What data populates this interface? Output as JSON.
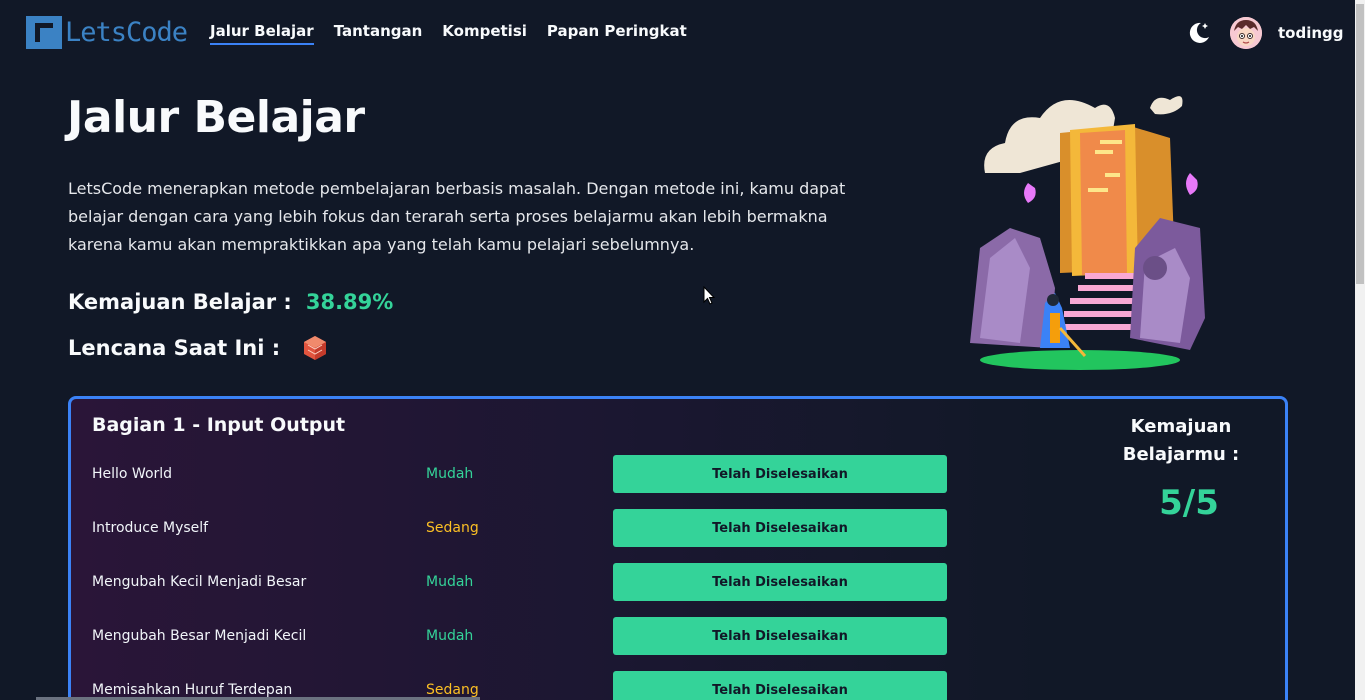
{
  "brand": {
    "name": "LetsCode"
  },
  "nav": {
    "items": [
      {
        "label": "Jalur Belajar",
        "active": true
      },
      {
        "label": "Tantangan",
        "active": false
      },
      {
        "label": "Kompetisi",
        "active": false
      },
      {
        "label": "Papan Peringkat",
        "active": false
      }
    ],
    "theme_icon": "moon-icon",
    "username": "todingg"
  },
  "hero": {
    "title": "Jalur Belajar",
    "description": "LetsCode menerapkan metode pembelajaran berbasis masalah. Dengan metode ini, kamu dapat belajar dengan cara yang lebih fokus dan terarah serta proses belajarmu akan lebih bermakna karena kamu akan mempraktikkan apa yang telah kamu pelajari sebelumnya.",
    "progress_label": "Kemajuan Belajar :",
    "progress_value": "38.89%",
    "badge_label": "Lencana Saat Ini :",
    "badge_icon": "cube-badge-icon"
  },
  "section": {
    "title": "Bagian 1 - Input Output",
    "rows": [
      {
        "name": "Hello World",
        "difficulty": "Mudah",
        "status": "Telah Diselesaikan"
      },
      {
        "name": "Introduce Myself",
        "difficulty": "Sedang",
        "status": "Telah Diselesaikan"
      },
      {
        "name": "Mengubah Kecil Menjadi Besar",
        "difficulty": "Mudah",
        "status": "Telah Diselesaikan"
      },
      {
        "name": "Mengubah Besar Menjadi Kecil",
        "difficulty": "Mudah",
        "status": "Telah Diselesaikan"
      },
      {
        "name": "Memisahkan Huruf Terdepan",
        "difficulty": "Sedang",
        "status": "Telah Diselesaikan"
      }
    ],
    "side_title": "Kemajuan Belajarmu :",
    "side_count": "5/5"
  },
  "colors": {
    "easy": "#34d399",
    "medium": "#fbbf24",
    "accent": "#3b82f6",
    "background": "#111827"
  }
}
